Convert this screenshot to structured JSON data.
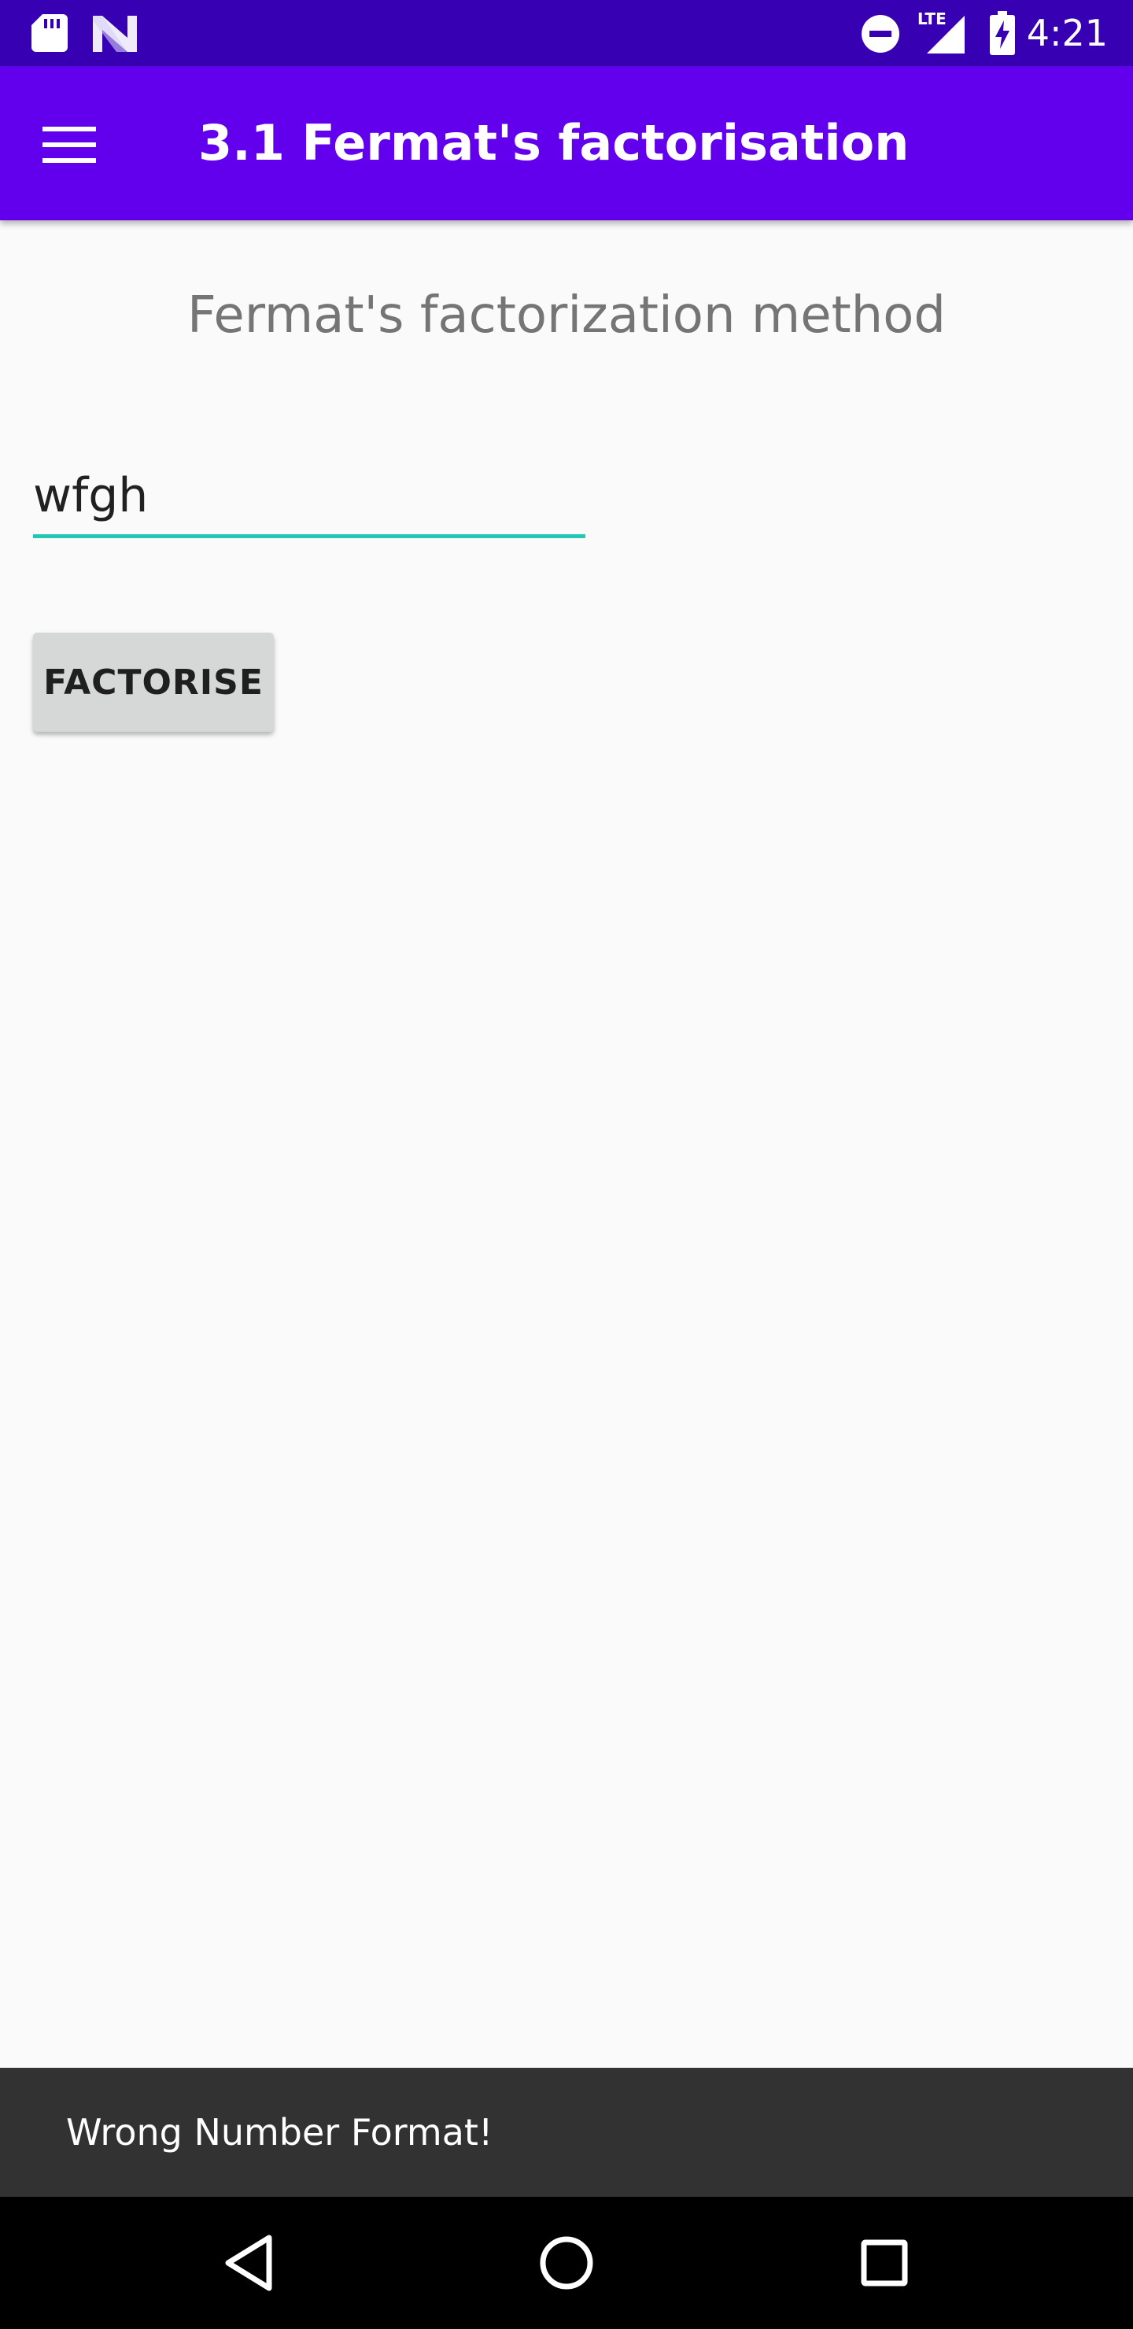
{
  "status_bar": {
    "time": "4:21",
    "left_icons": [
      "sd-card-icon",
      "n-notification-icon"
    ],
    "right_icons": [
      "do-not-disturb-icon",
      "lte-signal-icon",
      "battery-charging-icon"
    ],
    "network_label": "LTE"
  },
  "app_bar": {
    "menu_icon": "menu-icon",
    "title": "3.1 Fermat's factorisation",
    "background_color": "#6200ee"
  },
  "main": {
    "heading": "Fermat's factorization method",
    "number_input": {
      "value": "wfgh",
      "underline_color": "#26c6b5"
    },
    "factorise_button_label": "FACTORISE"
  },
  "snackbar": {
    "message": "Wrong Number Format!"
  },
  "nav_bar": {
    "buttons": [
      "back-icon",
      "home-icon",
      "recents-icon"
    ]
  }
}
